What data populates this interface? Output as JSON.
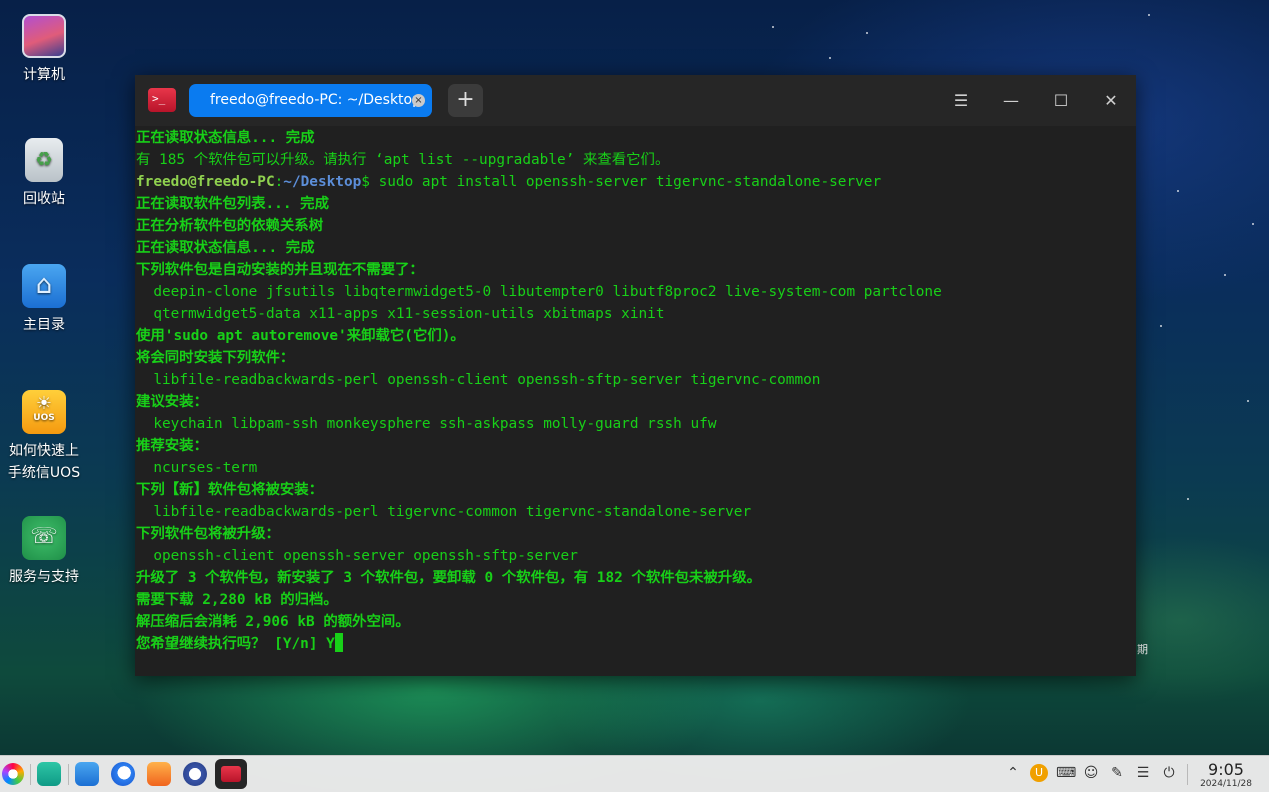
{
  "desktop": {
    "icons": [
      {
        "label": "计算机"
      },
      {
        "label": "回收站"
      },
      {
        "label": "主目录"
      },
      {
        "label_line1": "如何快速上",
        "label_line2": "手统信UOS"
      },
      {
        "label": "服务与支持"
      }
    ],
    "side_char": "期"
  },
  "terminal": {
    "tab_title": "freedo@freedo-PC: ~/Desktop",
    "new_tab_label": "+",
    "menu_icon": "menu-icon",
    "prompt_user": "freedo@freedo-PC",
    "prompt_sep": ":",
    "prompt_path": "~/Desktop",
    "prompt_dollar": "$ ",
    "command": "sudo apt install openssh-server tigervnc-standalone-server",
    "lines_before": [
      "正在读取状态信息... 完成",
      "有 185 个软件包可以升级。请执行 ‘apt list --upgradable’ 来查看它们。"
    ],
    "lines_after": [
      "正在读取软件包列表... 完成",
      "正在分析软件包的依赖关系树",
      "正在读取状态信息... 完成",
      "下列软件包是自动安装的并且现在不需要了：",
      "  deepin-clone jfsutils libqtermwidget5-0 libutempter0 libutf8proc2 live-system-com partclone",
      "  qtermwidget5-data x11-apps x11-session-utils xbitmaps xinit",
      "使用'sudo apt autoremove'来卸载它(它们)。",
      "将会同时安装下列软件：",
      "  libfile-readbackwards-perl openssh-client openssh-sftp-server tigervnc-common",
      "建议安装：",
      "  keychain libpam-ssh monkeysphere ssh-askpass molly-guard rssh ufw",
      "推荐安装：",
      "  ncurses-term",
      "下列【新】软件包将被安装：",
      "  libfile-readbackwards-perl tigervnc-common tigervnc-standalone-server",
      "下列软件包将被升级：",
      "  openssh-client openssh-server openssh-sftp-server",
      "升级了 3 个软件包，新安装了 3 个软件包，要卸载 0 个软件包，有 182 个软件包未被升级。",
      "需要下载 2,280 kB 的归档。",
      "解压缩后会消耗 2,906 kB 的额外空间。"
    ],
    "final_prompt": "您希望继续执行吗？ [Y/n] Y"
  },
  "taskbar": {
    "clock_time": "9:05",
    "clock_date": "2024/11/28"
  }
}
